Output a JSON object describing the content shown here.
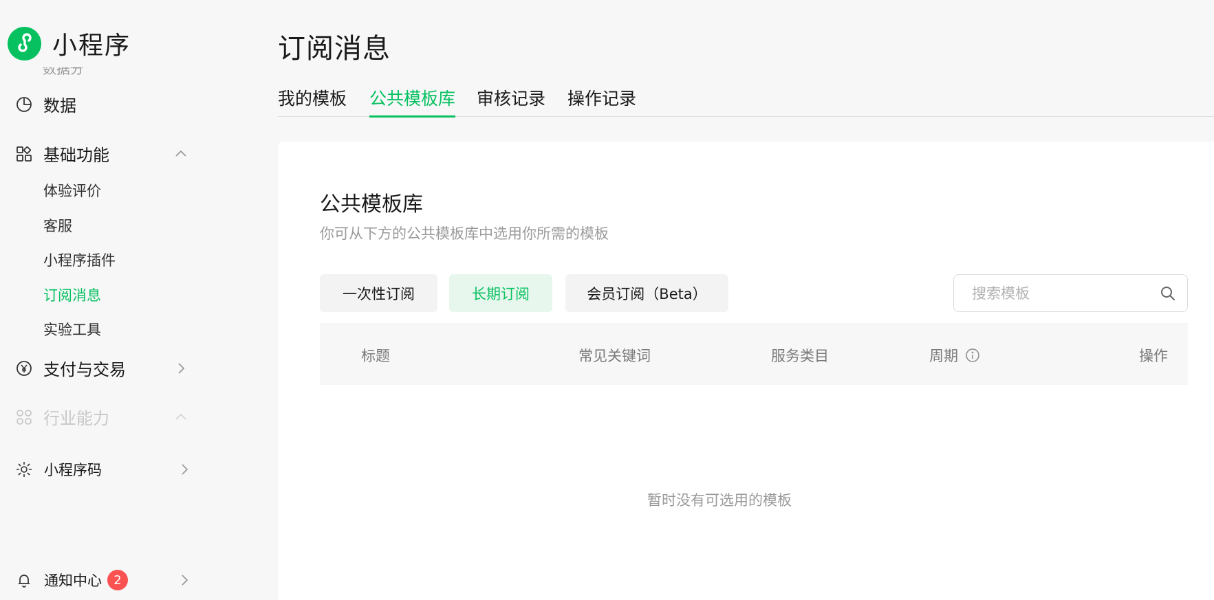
{
  "brand": {
    "title": "小程序",
    "logo_icon": "mini-program-logo"
  },
  "sidebar": {
    "cut_text": "数据分析",
    "items": [
      {
        "label": "数据",
        "icon": "pie-chart-icon"
      },
      {
        "label": "基础功能",
        "icon": "apps-grid-icon",
        "expanded": true
      },
      {
        "label": "支付与交易",
        "icon": "yen-circle-icon"
      },
      {
        "label": "行业能力",
        "icon": "industry-icon",
        "disabled": true
      },
      {
        "label": "小程序码",
        "icon": "qrcode-sun-icon"
      },
      {
        "label": "通知中心",
        "icon": "bell-icon",
        "badge": "2"
      }
    ],
    "sub_items": [
      "体验评价",
      "客服",
      "小程序插件",
      "订阅消息",
      "实验工具"
    ],
    "active_sub": "订阅消息"
  },
  "page": {
    "title": "订阅消息"
  },
  "tabs": [
    "我的模板",
    "公共模板库",
    "审核记录",
    "操作记录"
  ],
  "active_tab": "公共模板库",
  "card": {
    "title": "公共模板库",
    "description": "你可从下方的公共模板库中选用你所需的模板",
    "filters": [
      "一次性订阅",
      "长期订阅",
      "会员订阅（Beta）"
    ],
    "active_filter": "长期订阅",
    "search": {
      "placeholder": "搜索模板",
      "value": ""
    },
    "columns": [
      "标题",
      "常见关键词",
      "服务类目",
      "周期",
      "操作"
    ],
    "empty_text": "暂时没有可选用的模板"
  },
  "colors": {
    "accent": "#07c160",
    "badge": "#fa5151",
    "muted": "#9a9a9a"
  }
}
